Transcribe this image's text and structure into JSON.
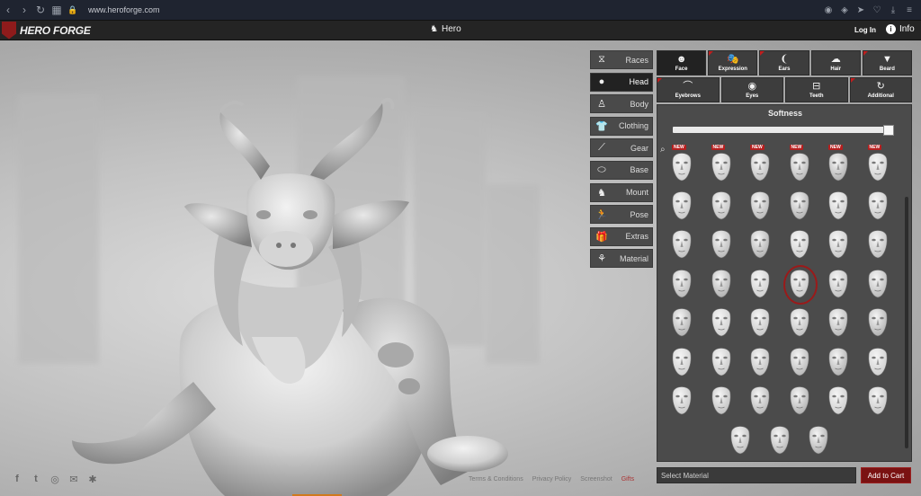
{
  "browser": {
    "url": "www.heroforge.com"
  },
  "header": {
    "logo_text": "HERO FORGE",
    "title": "Hero",
    "title_icon": "chess-piece-icon",
    "login": "Log In",
    "info": "Info"
  },
  "menu": {
    "items": [
      {
        "label": "Races",
        "icon": "dna-icon"
      },
      {
        "label": "Head",
        "icon": "head-icon",
        "active": true
      },
      {
        "label": "Body",
        "icon": "body-icon"
      },
      {
        "label": "Clothing",
        "icon": "shirt-icon"
      },
      {
        "label": "Gear",
        "icon": "sword-icon"
      },
      {
        "label": "Base",
        "icon": "base-icon"
      },
      {
        "label": "Mount",
        "icon": "horse-icon"
      },
      {
        "label": "Pose",
        "icon": "pose-icon"
      },
      {
        "label": "Extras",
        "icon": "gift-icon"
      },
      {
        "label": "Material",
        "icon": "material-icon"
      }
    ]
  },
  "tabs": {
    "row1": [
      {
        "label": "Face",
        "icon": "face-icon",
        "active": true
      },
      {
        "label": "Expression",
        "icon": "mask-icon"
      },
      {
        "label": "Ears",
        "icon": "ear-icon"
      },
      {
        "label": "Hair",
        "icon": "hair-icon"
      },
      {
        "label": "Beard",
        "icon": "beard-icon"
      }
    ],
    "row2": [
      {
        "label": "Eyebrows",
        "icon": "eyebrow-icon"
      },
      {
        "label": "Eyes",
        "icon": "eye-icon"
      },
      {
        "label": "Teeth",
        "icon": "teeth-icon"
      },
      {
        "label": "Additional",
        "icon": "refresh-icon"
      }
    ]
  },
  "parts": {
    "softness_label": "Softness",
    "softness_value": 1.0,
    "new_badge": "NEW"
  },
  "bottom": {
    "material_placeholder": "Select Material",
    "add_to_cart": "Add to Cart"
  },
  "footer": {
    "links": [
      "Terms & Conditions",
      "Privacy Policy",
      "Screenshot",
      "Gifts"
    ],
    "social": [
      "facebook-icon",
      "twitter-icon",
      "instagram-icon",
      "mail-icon",
      "bug-icon"
    ]
  },
  "colors": {
    "accent_red": "#8e1b1b",
    "panel_bg": "#4b4b4b"
  }
}
